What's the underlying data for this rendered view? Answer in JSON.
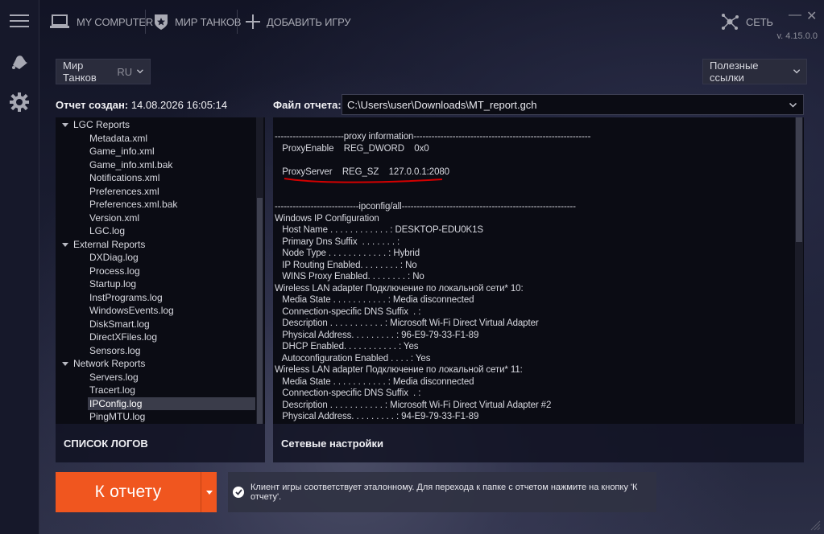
{
  "colors": {
    "accent": "#f0561f",
    "underline": "#d40000",
    "selected_row": "#3a3c4a"
  },
  "topbar": {
    "my_computer": "MY COMPUTER",
    "game_tab": "МИР ТАНКОВ",
    "add_game": "ДОБАВИТЬ ИГРУ",
    "network": "СЕТЬ",
    "minimize": "—",
    "close": "✕",
    "version": "v. 4.15.0.0"
  },
  "game_select": {
    "name": "Мир Танков",
    "region": "RU"
  },
  "links_select": {
    "label": "Полезные ссылки"
  },
  "report": {
    "created_label": "Отчет создан:",
    "created_value": "14.08.2026 16:05:14",
    "file_label": "Файл отчета:",
    "file_value": "C:\\Users\\user\\Downloads\\MT_report.gch"
  },
  "tree": {
    "items": [
      {
        "label": "LGC Reports",
        "level": 0,
        "group": true
      },
      {
        "label": "Metadata.xml",
        "level": 1
      },
      {
        "label": "Game_info.xml",
        "level": 1
      },
      {
        "label": "Game_info.xml.bak",
        "level": 1
      },
      {
        "label": "Notifications.xml",
        "level": 1
      },
      {
        "label": "Preferences.xml",
        "level": 1
      },
      {
        "label": "Preferences.xml.bak",
        "level": 1
      },
      {
        "label": "Version.xml",
        "level": 1
      },
      {
        "label": "LGC.log",
        "level": 1
      },
      {
        "label": "External Reports",
        "level": 0,
        "group": true
      },
      {
        "label": "DXDiag.log",
        "level": 1
      },
      {
        "label": "Process.log",
        "level": 1
      },
      {
        "label": "Startup.log",
        "level": 1
      },
      {
        "label": "InstPrograms.log",
        "level": 1
      },
      {
        "label": "WindowsEvents.log",
        "level": 1
      },
      {
        "label": "DiskSmart.log",
        "level": 1
      },
      {
        "label": "DirectXFiles.log",
        "level": 1
      },
      {
        "label": "Sensors.log",
        "level": 1
      },
      {
        "label": "Network Reports",
        "level": 0,
        "group": true
      },
      {
        "label": "Servers.log",
        "level": 1
      },
      {
        "label": "Tracert.log",
        "level": 1
      },
      {
        "label": "IPConfig.log",
        "level": 1,
        "selected": true
      },
      {
        "label": "PingMTU.log",
        "level": 1
      }
    ]
  },
  "log": {
    "lines": [
      "-----------------------proxy information-----------------------------------------------------------",
      "   ProxyEnable    REG_DWORD    0x0",
      "",
      "   ProxyServer    REG_SZ    127.0.0.1:2080",
      "",
      "",
      "----------------------------ipconfig/all----------------------------------------------------------",
      "Windows IP Configuration",
      "   Host Name . . . . . . . . . . . . : DESKTOP-EDU0K1S",
      "   Primary Dns Suffix  . . . . . . . :",
      "   Node Type . . . . . . . . . . . . : Hybrid",
      "   IP Routing Enabled. . . . . . . . : No",
      "   WINS Proxy Enabled. . . . . . . . : No",
      "Wireless LAN adapter Подключение по локальной сети* 10:",
      "   Media State . . . . . . . . . . . : Media disconnected",
      "   Connection-specific DNS Suffix  . :",
      "   Description . . . . . . . . . . . : Microsoft Wi-Fi Direct Virtual Adapter",
      "   Physical Address. . . . . . . . . : 96-E9-79-33-F1-89",
      "   DHCP Enabled. . . . . . . . . . . : Yes",
      "   Autoconfiguration Enabled . . . . : Yes",
      "Wireless LAN adapter Подключение по локальной сети* 11:",
      "   Media State . . . . . . . . . . . : Media disconnected",
      "   Connection-specific DNS Suffix  . :",
      "   Description . . . . . . . . . . . : Microsoft Wi-Fi Direct Virtual Adapter #2",
      "   Physical Address. . . . . . . . . : 94-E9-79-33-F1-89"
    ]
  },
  "footer": {
    "logs_list": "СПИСОК ЛОГОВ",
    "network_settings": "Сетевые настройки",
    "report_button": "К отчету",
    "status_text": "Клиент игры соответствует эталонному. Для перехода к папке с отчетом нажмите на кнопку 'К отчету'."
  },
  "icons": {
    "rail": [
      "menu-icon",
      "bell-icon",
      "settings-gear-icon"
    ],
    "topbar": [
      "laptop-icon",
      "tank-shield-icon",
      "plus-icon",
      "network-nodes-icon"
    ]
  }
}
